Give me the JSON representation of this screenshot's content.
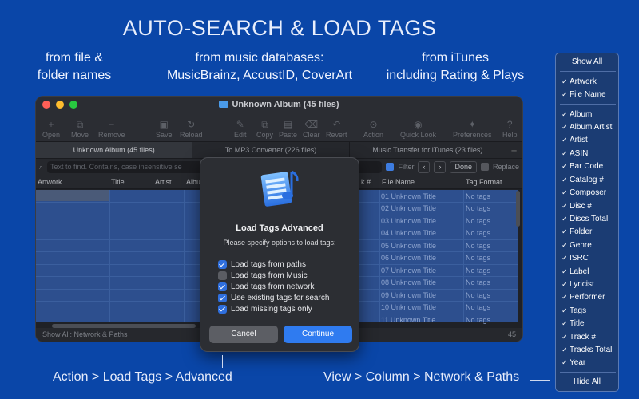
{
  "headline": "AUTO-SEARCH & LOAD TAGS",
  "subtitles": {
    "files": [
      "from file &",
      "folder names"
    ],
    "databases": [
      "from music databases:",
      "MusicBrainz, AcoustID, CoverArt"
    ],
    "itunes": [
      "from iTunes",
      "including Rating & Plays"
    ]
  },
  "window": {
    "title": "Unknown Album (45 files)",
    "toolbar": [
      "Open",
      "Move",
      "Remove",
      "Save",
      "Reload",
      "Edit",
      "Copy",
      "Paste",
      "Clear",
      "Revert",
      "Action",
      "Quick Look",
      "Preferences",
      "Help"
    ],
    "tabs": [
      "Unknown Album (45 files)",
      "To MP3 Converter (226 files)",
      "Music Transfer for iTunes (23 files)"
    ],
    "tab_add": "+",
    "search_placeholder": "Text to find. Contains, case insensitive se",
    "filter_label": "Filter",
    "done_label": "Done",
    "replace_label": "Replace",
    "columns": [
      "Artwork",
      "Title",
      "Artist",
      "Albu",
      "k #",
      "File Name",
      "Tag Format"
    ],
    "rows": [
      {
        "file": "01 Unknown Title",
        "tag": "No tags"
      },
      {
        "file": "02 Unknown Title",
        "tag": "No tags"
      },
      {
        "file": "03 Unknown Title",
        "tag": "No tags"
      },
      {
        "file": "04 Unknown Title",
        "tag": "No tags"
      },
      {
        "file": "05 Unknown Title",
        "tag": "No tags"
      },
      {
        "file": "06 Unknown Title",
        "tag": "No tags"
      },
      {
        "file": "07 Unknown Title",
        "tag": "No tags"
      },
      {
        "file": "08 Unknown Title",
        "tag": "No tags"
      },
      {
        "file": "09 Unknown Title",
        "tag": "No tags"
      },
      {
        "file": "10 Unknown Title",
        "tag": "No tags"
      },
      {
        "file": "11 Unknown Title",
        "tag": "No tags"
      }
    ],
    "status": "Show All: Network & Paths",
    "count": "45"
  },
  "dialog": {
    "title": "Load Tags Advanced",
    "subtitle": "Please specify options to load tags:",
    "options": [
      {
        "label": "Load tags from paths",
        "checked": true
      },
      {
        "label": "Load tags from Music",
        "checked": false
      },
      {
        "label": "Load tags from network",
        "checked": true
      },
      {
        "label": "Use existing tags for search",
        "checked": true
      },
      {
        "label": "Load missing tags only",
        "checked": true
      }
    ],
    "cancel_label": "Cancel",
    "continue_label": "Continue"
  },
  "menu": {
    "show_all": "Show All",
    "group1": [
      "Artwork",
      "File Name"
    ],
    "group2": [
      "Album",
      "Album Artist",
      "Artist",
      "ASIN",
      "Bar Code",
      "Catalog #",
      "Composer",
      "Disc #",
      "Discs Total",
      "Folder",
      "Genre",
      "ISRC",
      "Label",
      "Lyricist",
      "Performer",
      "Tags",
      "Title",
      "Track #",
      "Tracks Total",
      "Year"
    ],
    "hide_all": "Hide All"
  },
  "captions": {
    "left": "Action > Load Tags > Advanced",
    "right": "View > Column > Network & Paths"
  },
  "colors": {
    "background": "#0a46a8",
    "accent": "#2f7bf0"
  }
}
